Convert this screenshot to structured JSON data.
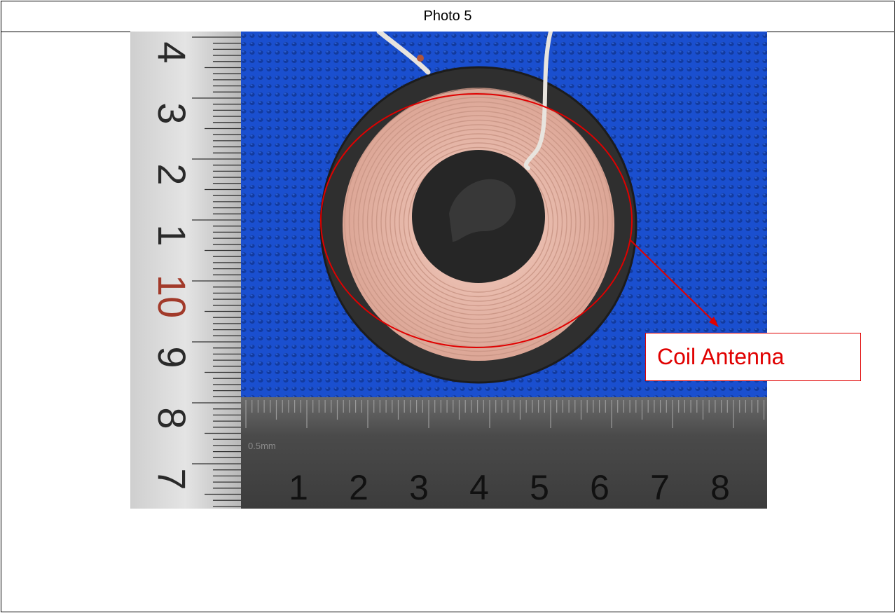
{
  "page": {
    "title": "Photo 5"
  },
  "photo": {
    "subject": "coil-antenna-with-rulers",
    "colors": {
      "background_cloth": "#1b55d8",
      "ruler_metal": "#bdbdbd",
      "ruler_dark": "#3a3a3a",
      "coil_copper": "#e8b6a6",
      "ferrite": "#2e2e2e",
      "highlight": "#e00000"
    },
    "vertical_ruler_numbers": [
      "4",
      "3",
      "2",
      "1",
      "10",
      "9",
      "8",
      "7"
    ],
    "horizontal_ruler_numbers": [
      "1",
      "2",
      "3",
      "4",
      "5",
      "6",
      "7",
      "8"
    ],
    "horizontal_ruler_mark": "0.5mm"
  },
  "annotation": {
    "label": "Coil Antenna"
  }
}
